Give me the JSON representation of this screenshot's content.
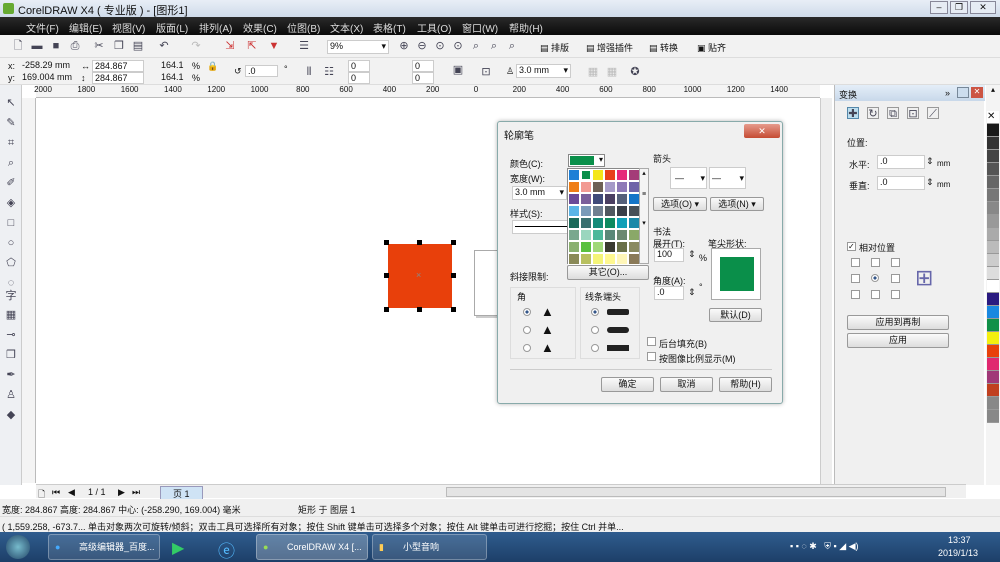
{
  "window": {
    "title": "CorelDRAW X4 ( 专业版 ) - [图形1]"
  },
  "menu": [
    "文件(F)",
    "编辑(E)",
    "视图(V)",
    "版面(L)",
    "排列(A)",
    "效果(C)",
    "位图(B)",
    "文本(X)",
    "表格(T)",
    "工具(O)",
    "窗口(W)",
    "帮助(H)"
  ],
  "toolbar": {
    "zoom": "9%",
    "plugins": [
      "排版",
      "增强插件",
      "转换",
      "贴齐"
    ]
  },
  "propbar": {
    "x": "-258.29 mm",
    "y": "169.004 mm",
    "w": "284.867 mm",
    "h": "284.867 mm",
    "sx": "164.1",
    "sy": "164.1",
    "pct": "%",
    "rotation": ".0",
    "deg": "°",
    "c1": "0",
    "c2": "0",
    "c3": "0",
    "c4": "0",
    "outline": "3.0 mm"
  },
  "ruler": {
    "top": [
      "2000",
      "1800",
      "1600",
      "1400",
      "1200",
      "1000",
      "800",
      "600",
      "400",
      "200",
      "0",
      "200",
      "400",
      "600",
      "800",
      "1000",
      "1200",
      "1400"
    ]
  },
  "dialog": {
    "title": "轮廓笔",
    "color_label": "颜色(C):",
    "width_label": "宽度(W):",
    "width_value": "3.0 mm",
    "style_label": "样式(S):",
    "other_button": "其它(O)...",
    "miter_label": "斜接限制:",
    "corner_label": "角",
    "linecap_label": "线条端头",
    "arrow_label": "箭头",
    "options1": "选项(O)",
    "options2": "选项(N)",
    "calligraphy_label": "书法",
    "stretch_label": "展开(T):",
    "stretch_value": "100",
    "pct": "%",
    "angle_label": "角度(A):",
    "angle_value": ".0",
    "deg": "°",
    "nib_label": "笔尖形状:",
    "default_button": "默认(D)",
    "behind_fill": "后台填充(B)",
    "scale_with_image": "按图像比例显示(M)",
    "ok": "确定",
    "cancel": "取消",
    "help": "帮助(H)",
    "palette": [
      "#1e7fd6",
      "#0a8f4a",
      "#f4e61a",
      "#e8401b",
      "#e6287a",
      "#a43c78",
      "#ef7d16",
      "#f29a92",
      "#6d6055",
      "#a59ac8",
      "#8e7ab8",
      "#6f64a8",
      "#6a4a98",
      "#7a5f9a",
      "#3f4a7a",
      "#4a3f62",
      "#55607a",
      "#1575c8",
      "#5ab4e6",
      "#7a9ab8",
      "#6f7f90",
      "#505860",
      "#3a3f48",
      "#485058",
      "#1a6a5a",
      "#3a7070",
      "#148a78",
      "#0e8a60",
      "#10a0b8",
      "#1b88a8",
      "#7aa88e",
      "#9ad6be",
      "#4ab89a",
      "#5a8878",
      "#6a8870",
      "#8aa868",
      "#8ab070",
      "#5ac040",
      "#a0d878",
      "#3a3a30",
      "#6a7048",
      "#8a8a60",
      "#8a8a58",
      "#b8c060",
      "#f4f478",
      "#fff890",
      "#fff6b8",
      "#8a7a58"
    ],
    "selected_color": "#0a8f4a"
  },
  "docker": {
    "title": "变换",
    "position_label": "位置:",
    "h_label": "水平:",
    "h_value": ".0",
    "v_label": "垂直:",
    "v_value": ".0",
    "unit": "mm",
    "relative": "相对位置",
    "apply_dup": "应用到再制",
    "apply": "应用"
  },
  "colorbar": [
    "#ffffff",
    "#1a1a1a",
    "#333",
    "#444",
    "#555",
    "#666",
    "#777",
    "#888",
    "#999",
    "#aaa",
    "#bbb",
    "#ccc",
    "#ddd",
    "#fff",
    "#2a1a80",
    "#1a88e0",
    "#109048",
    "#f4f010",
    "#e8400b",
    "#e02870",
    "#a03878",
    "#c04020",
    "#888",
    "#888"
  ],
  "pagebar": {
    "page": "1 / 1",
    "tab": "页 1"
  },
  "status": {
    "line1": "宽度: 284.867 高度: 284.867 中心: (-258.290, 169.004) 毫米",
    "layer": "矩形 于 图层 1",
    "line2": "( 1,559.258, -673.7...  单击对象两次可旋转/倾斜；双击工具可选择所有对象；按住 Shift 键单击可选择多个对象；按住 Alt 键单击可进行挖掘；按住 Ctrl 并单..."
  },
  "taskbar": {
    "tasks": [
      "高级编辑器_百度...",
      "CorelDRAW X4 [...",
      "小型音响"
    ],
    "time": "13:37",
    "date": "2019/1/13"
  }
}
